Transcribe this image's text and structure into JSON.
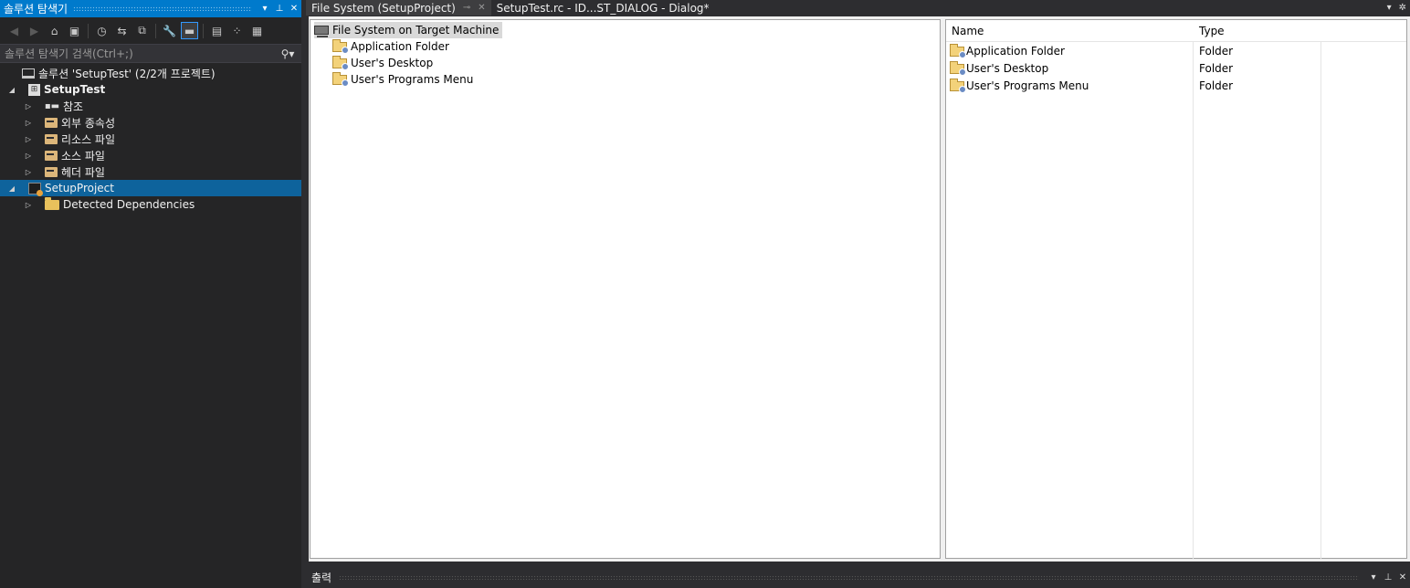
{
  "solution_explorer": {
    "title": "솔루션 탐색기",
    "search_placeholder": "솔루션 탐색기 검색(Ctrl+;)",
    "tree": {
      "solution": "솔루션 'SetupTest' (2/2개 프로젝트)",
      "project1": "SetupTest",
      "references": "참조",
      "external_deps": "외부 종속성",
      "resource_files": "리소스 파일",
      "source_files": "소스 파일",
      "header_files": "헤더 파일",
      "project2": "SetupProject",
      "detected_deps": "Detected Dependencies"
    }
  },
  "tabs": {
    "active": "File System (SetupProject)",
    "second": "SetupTest.rc - ID...ST_DIALOG - Dialog*"
  },
  "file_system": {
    "root": "File System on Target Machine",
    "folders": [
      "Application Folder",
      "User's Desktop",
      "User's Programs Menu"
    ]
  },
  "list_view": {
    "columns": [
      "Name",
      "Type"
    ],
    "rows": [
      {
        "name": "Application Folder",
        "type": "Folder"
      },
      {
        "name": "User's Desktop",
        "type": "Folder"
      },
      {
        "name": "User's Programs Menu",
        "type": "Folder"
      }
    ]
  },
  "output": {
    "title": "출력"
  },
  "colors": {
    "accent": "#007acc",
    "selection": "#0e639c",
    "sidebar_bg": "#252526"
  }
}
